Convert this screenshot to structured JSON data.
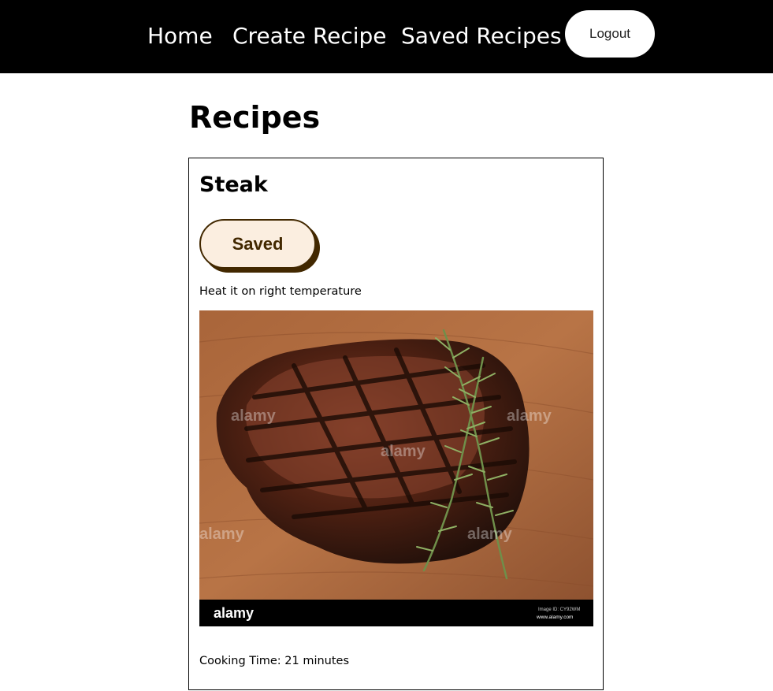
{
  "nav": {
    "home": "Home",
    "create_recipe": "Create Recipe",
    "saved_recipes": "Saved Recipes",
    "logout": "Logout"
  },
  "page": {
    "title": "Recipes"
  },
  "recipes": [
    {
      "name": "Steak",
      "save_button": "Saved",
      "instructions": "Heat it on right temperature",
      "image": {
        "watermark": "alamy",
        "footer_logo": "alamy",
        "image_id": "Image ID: CY92WM",
        "site": "www.alamy.com"
      },
      "cooking_time": "Cooking Time: 21 minutes"
    }
  ],
  "colors": {
    "navbar_bg": "#000000",
    "save_button_bg": "#fbeee0",
    "save_button_border": "#422800"
  }
}
